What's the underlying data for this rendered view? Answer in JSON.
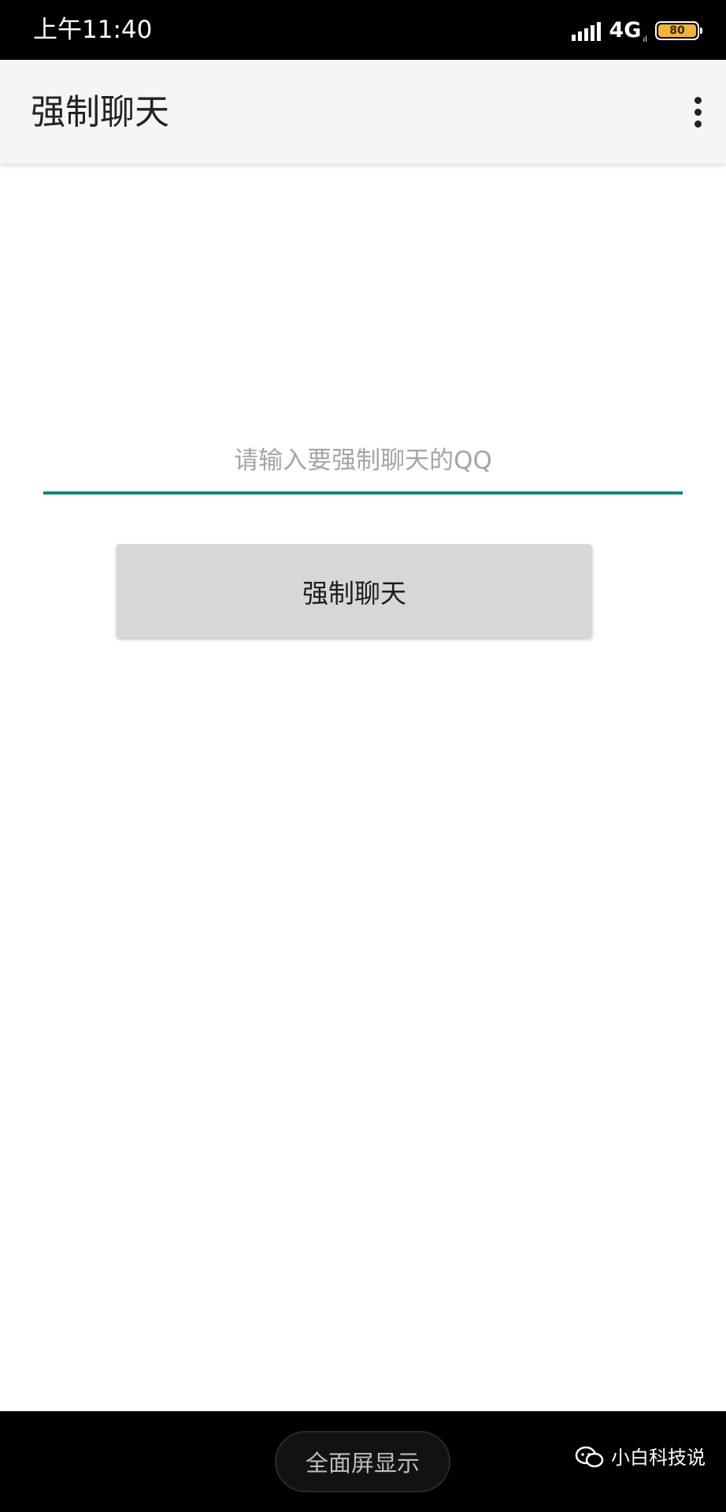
{
  "status_bar": {
    "time": "上午11:40",
    "network": "4G",
    "network_sub": "ıl",
    "battery_level": "80",
    "battery_color": "#f2b33d",
    "icons": [
      "signal-icon",
      "battery-icon"
    ]
  },
  "app_bar": {
    "title": "强制聊天",
    "menu_icon": "more-vert-icon"
  },
  "form": {
    "input_value": "",
    "input_placeholder": "请输入要强制聊天的QQ",
    "accent_color": "#19857b",
    "button_label": "强制聊天"
  },
  "bottom_bar": {
    "fullscreen_label": "全面屏显示",
    "watermark_text": "小白科技说",
    "watermark_icon": "wechat-icon"
  }
}
